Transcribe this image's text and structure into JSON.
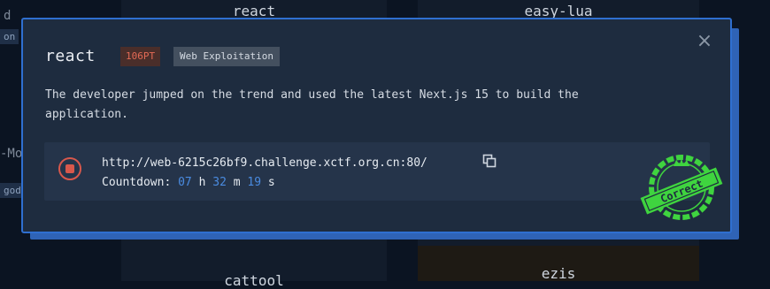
{
  "background": {
    "card_titles": [
      "react",
      "easy-lua",
      "cattool",
      "ezis"
    ],
    "left_fragments": [
      "d",
      "on",
      "-Mo",
      "god"
    ]
  },
  "modal": {
    "title": "react",
    "points": "106PT",
    "category": "Web Exploitation",
    "description": "The developer jumped on the trend and used the latest Next.js 15 to build the application.",
    "instance": {
      "url": "http://web-6215c26bf9.challenge.xctf.org.cn:80/",
      "countdown_label": "Countdown:",
      "hours": "07",
      "hours_unit": "h",
      "minutes": "32",
      "minutes_unit": "m",
      "seconds": "19",
      "seconds_unit": "s"
    },
    "stamp_text": "Correct",
    "close_icon": "close-icon",
    "stop_icon": "stop-icon",
    "copy_icon": "copy-icon"
  },
  "colors": {
    "modal_border": "#2f6fd0",
    "points": "#e36a55",
    "countdown_numbers": "#4a8be0",
    "stamp": "#3fd43f",
    "stop": "#d8584c"
  }
}
